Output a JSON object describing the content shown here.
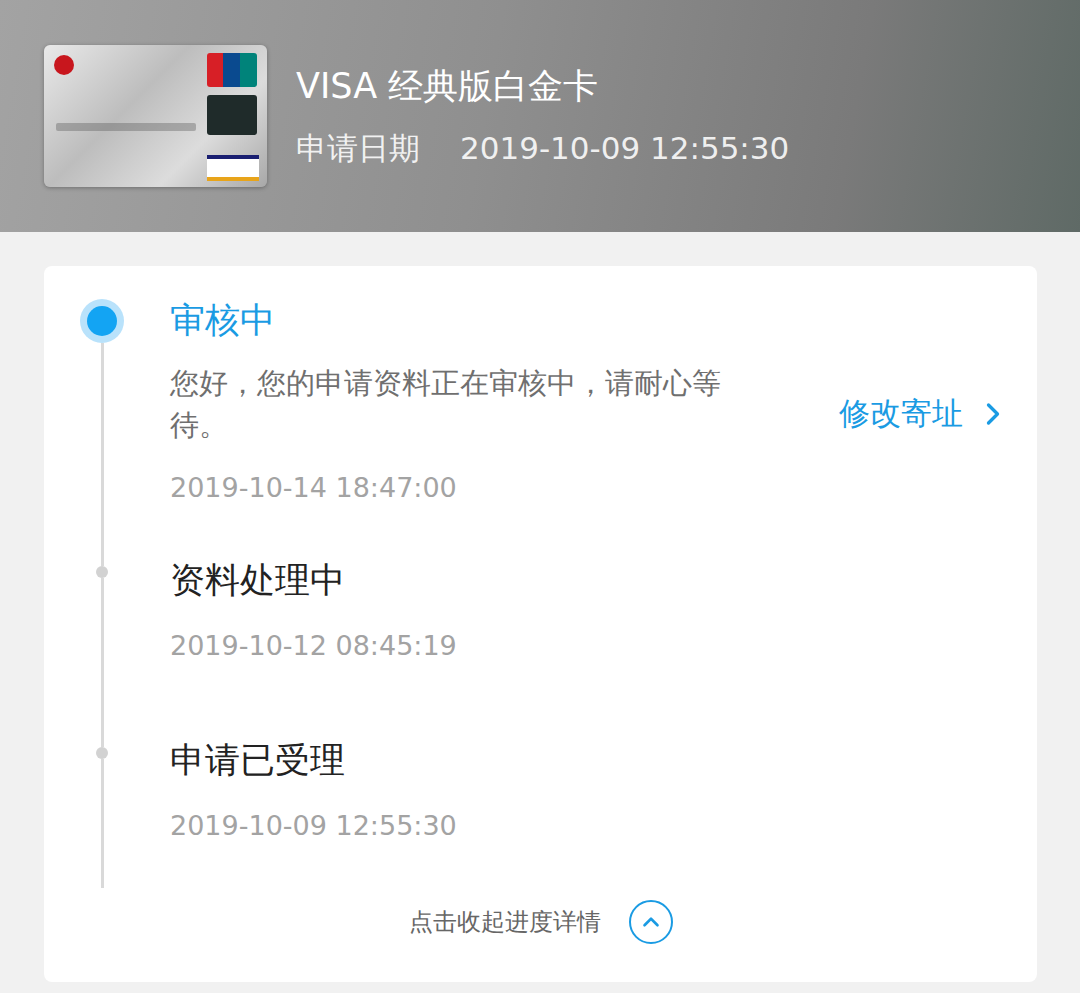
{
  "header": {
    "title": "VISA 经典版白金卡",
    "date_label": "申请日期",
    "date": "2019-10-09 12:55:30"
  },
  "steps": [
    {
      "title": "审核中",
      "description": "您好，您的申请资料正在审核中，请耐心等待。",
      "time": "2019-10-14 18:47:00",
      "selected": true,
      "action": "修改寄址"
    },
    {
      "title": "资料处理中",
      "time": "2019-10-12 08:45:19",
      "selected": false
    },
    {
      "title": "申请已受理",
      "time": "2019-10-09 12:55:30",
      "selected": false
    }
  ],
  "footer": {
    "label": "点击收起进度详情",
    "expanded": true
  }
}
